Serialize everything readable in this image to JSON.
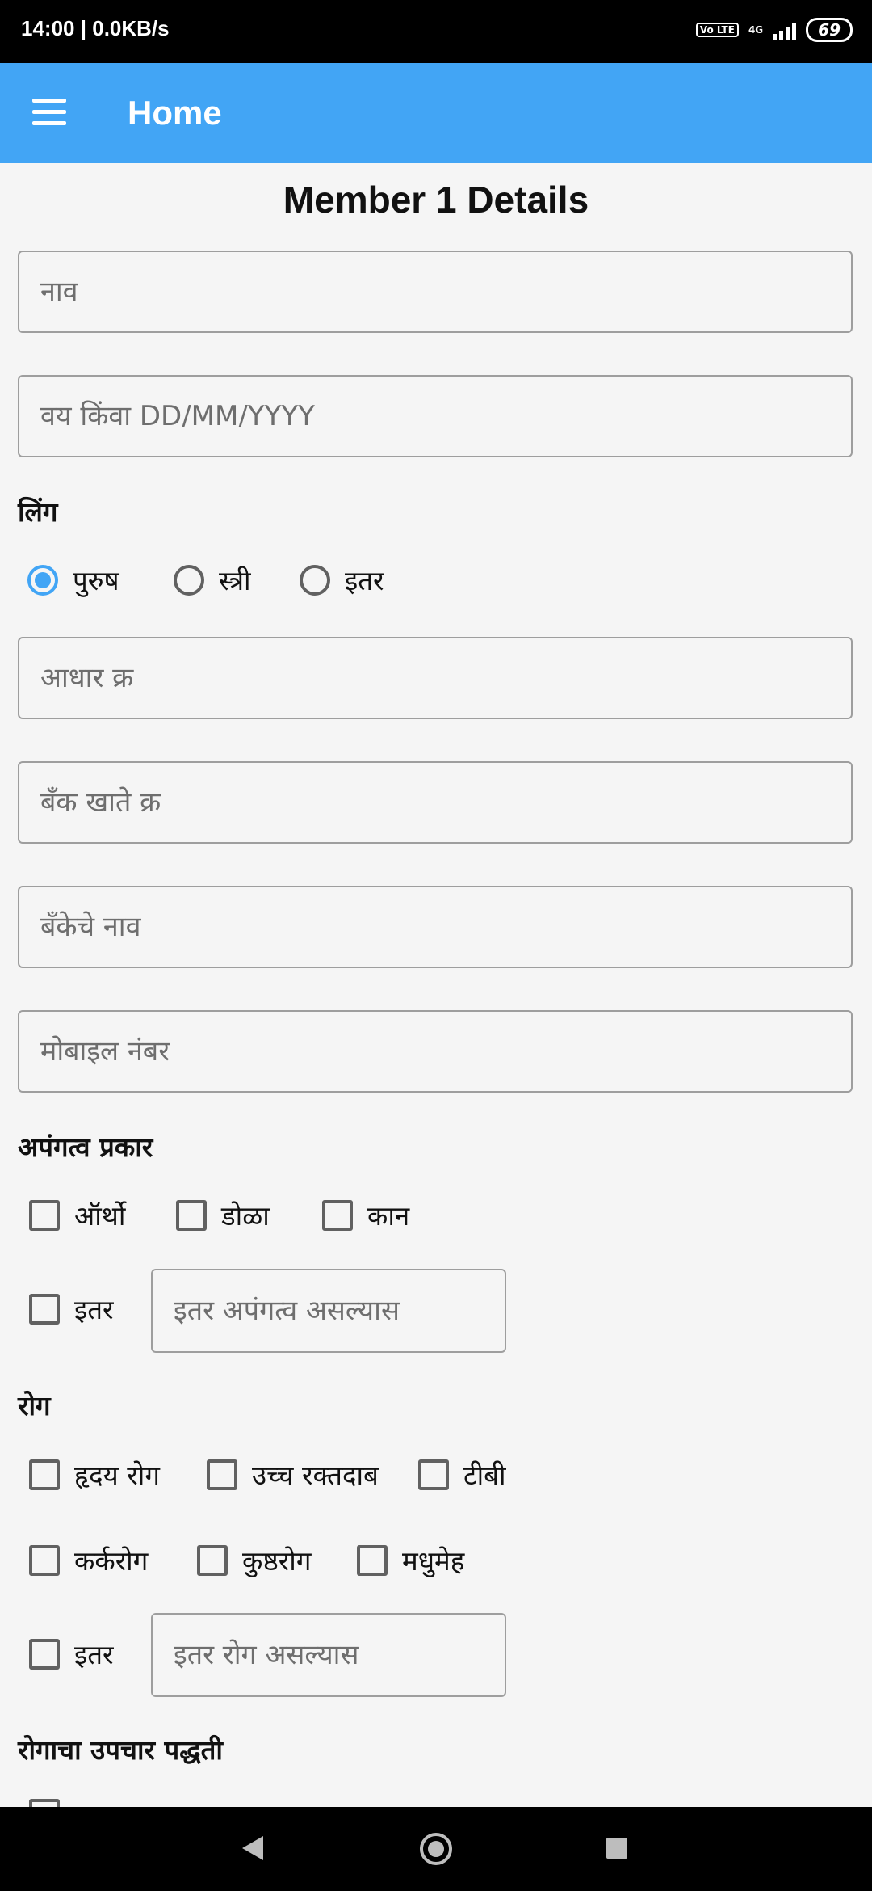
{
  "status_bar": {
    "time": "14:00",
    "speed": "0.0KB/s",
    "volte": "Vo LTE",
    "network": "4G",
    "battery": "69"
  },
  "app_bar": {
    "menu_icon": "hamburger-menu-icon",
    "title": "Home"
  },
  "form": {
    "title": "Member 1 Details",
    "name_placeholder": "नाव",
    "age_placeholder": "वय किंवा DD/MM/YYYY",
    "gender": {
      "label": "लिंग",
      "options": [
        "पुरुष",
        "स्त्री",
        "इतर"
      ],
      "selected": "पुरुष"
    },
    "aadhar_placeholder": "आधार क्र",
    "bank_account_placeholder": "बँक खाते क्र",
    "bank_name_placeholder": "बँकेचे नाव",
    "mobile_placeholder": "मोबाइल नंबर",
    "disability": {
      "label": "अपंगत्व प्रकार",
      "options": [
        "ऑर्थो",
        "डोळा",
        "कान",
        "इतर"
      ],
      "other_placeholder": "इतर अपंगत्व असल्यास"
    },
    "disease": {
      "label": "रोग",
      "options": [
        "हृदय रोग",
        "उच्च रक्तदाब",
        "टीबी",
        "कर्करोग",
        "कुष्ठरोग",
        "मधुमेह",
        "इतर"
      ],
      "other_placeholder": "इतर रोग असल्यास"
    },
    "treatment": {
      "label": "रोगाचा उपचार पद्धती"
    }
  },
  "colors": {
    "app_bar": "#42a5f5",
    "accent": "#42a5f5",
    "background": "#f5f5f5"
  }
}
